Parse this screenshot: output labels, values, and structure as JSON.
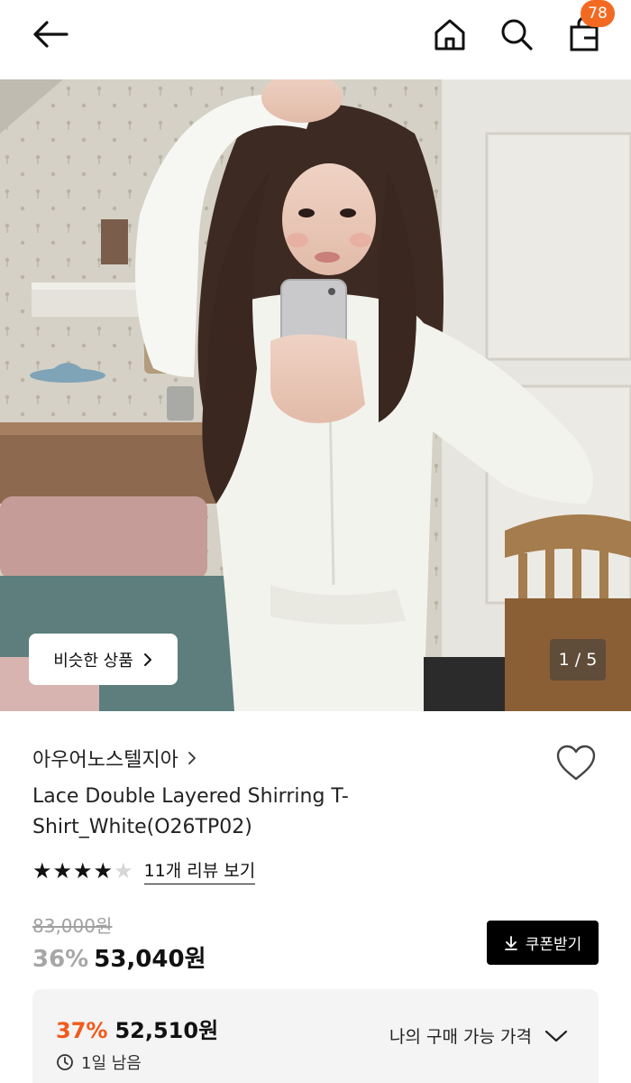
{
  "header": {
    "cart_count": "78"
  },
  "hero": {
    "similar_label": "비슷한 상품",
    "counter": "1 / 5"
  },
  "product": {
    "brand": "아우어노스텔지아",
    "title": "Lace Double Layered Shirring T-Shirt_White(O26TP02)",
    "rating": 4,
    "rating_max": 5,
    "review_link": "11개 리뷰 보기",
    "original_price": "83,000원",
    "discount_pct": "36%",
    "sale_price": "53,040원",
    "coupon_label": "쿠폰받기"
  },
  "promo": {
    "pct": "37%",
    "price": "52,510원",
    "time_left": "1일 남음",
    "dropdown_label": "나의 구매 가능 가격"
  },
  "colors": {
    "accent": "#f26a22",
    "promo_pct": "#f2591c"
  }
}
